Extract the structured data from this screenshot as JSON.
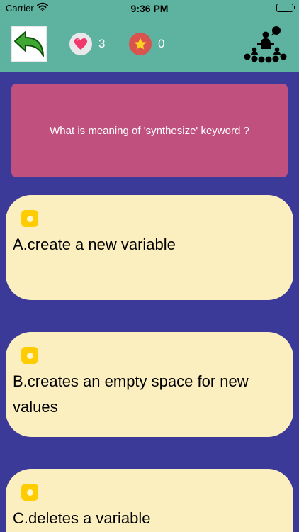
{
  "status_bar": {
    "carrier": "Carrier",
    "time": "9:36 PM"
  },
  "header": {
    "lives_count": "3",
    "stars_count": "0",
    "icons": {
      "back": "green-back-arrow-icon",
      "lives": "heart-icon",
      "stars": "star-icon",
      "audience": "audience-poll-icon"
    }
  },
  "question": {
    "text": "What is meaning of 'synthesize' keyword ?"
  },
  "answers": [
    {
      "label": "A.create a new variable"
    },
    {
      "label": "B.creates an empty space for new values"
    },
    {
      "label": "C.deletes a variable"
    }
  ],
  "colors": {
    "header_bg": "#5db3a0",
    "page_bg": "#3c3a98",
    "question_bg": "#c0517f",
    "answer_bg": "#fbefbf",
    "bullet": "#ffcc00"
  }
}
